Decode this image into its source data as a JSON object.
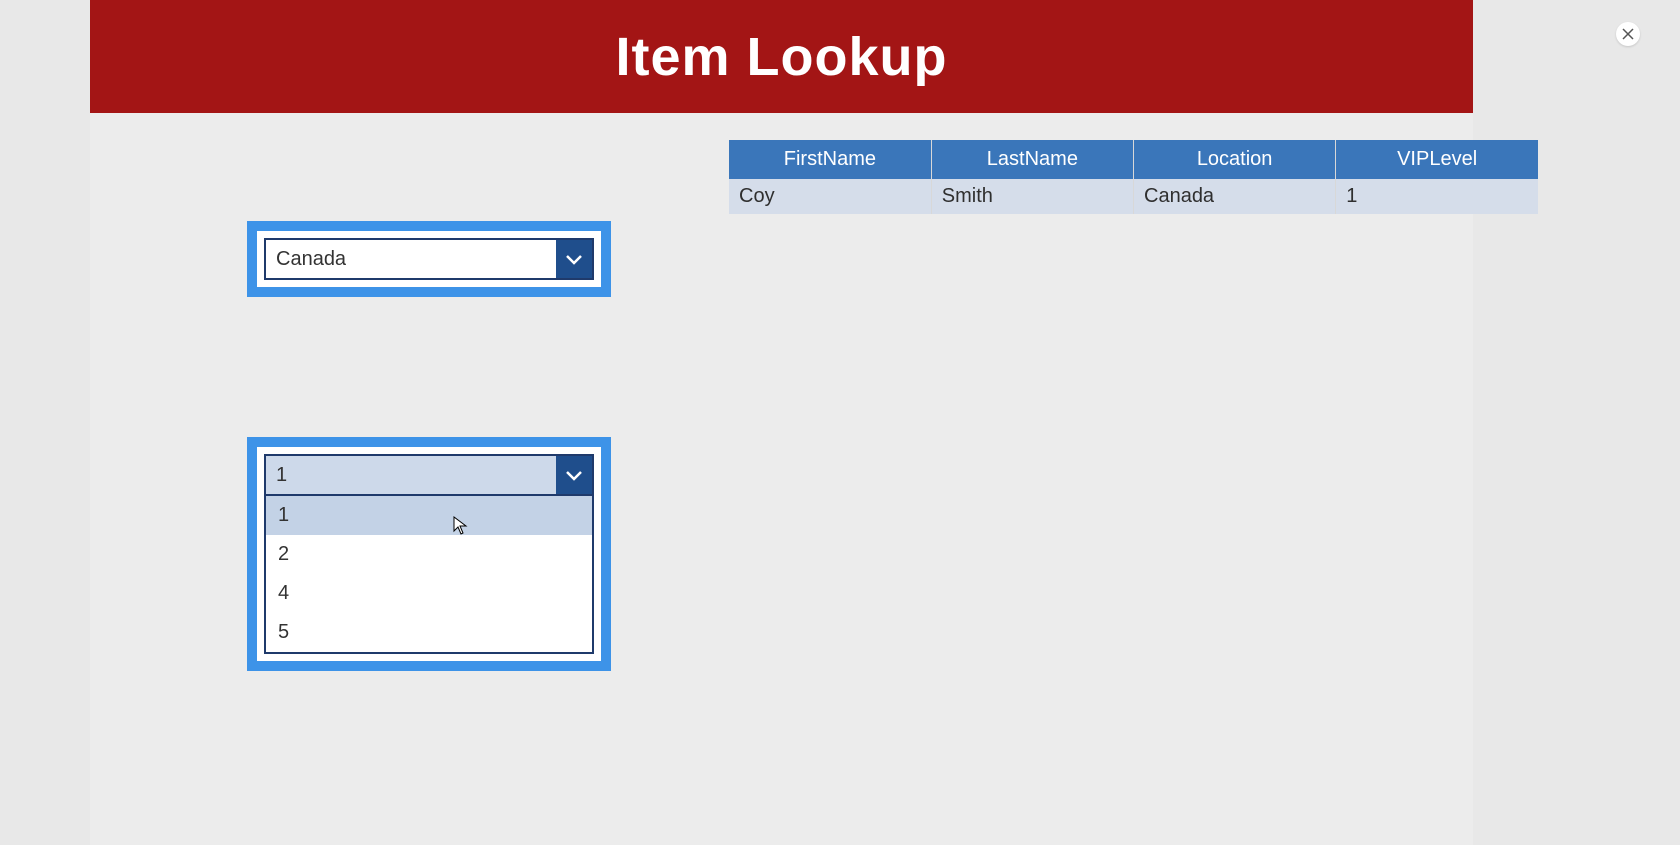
{
  "header": {
    "title": "Item Lookup"
  },
  "table": {
    "headers": [
      "FirstName",
      "LastName",
      "Location",
      "VIPLevel"
    ],
    "rows": [
      {
        "first": "Coy",
        "last": "Smith",
        "location": "Canada",
        "vip": "1"
      }
    ]
  },
  "dropdowns": {
    "location": {
      "selected": "Canada"
    },
    "vip": {
      "selected": "1",
      "options": [
        "1",
        "2",
        "4",
        "5"
      ],
      "hover_index": 0
    }
  }
}
